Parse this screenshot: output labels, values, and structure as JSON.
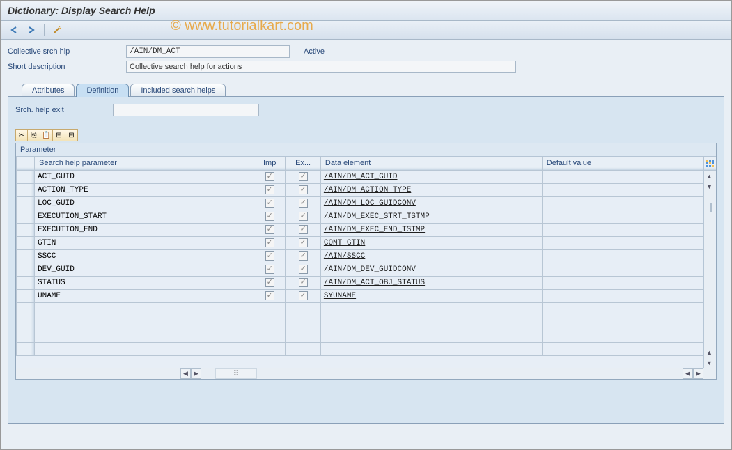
{
  "title": "Dictionary: Display Search Help",
  "watermark": "© www.tutorialkart.com",
  "toolbar": {},
  "fields": {
    "collective_label": "Collective srch hlp",
    "collective_value": "/AIN/DM_ACT",
    "status": "Active",
    "shortdesc_label": "Short description",
    "shortdesc_value": "Collective search help for actions"
  },
  "tabs": {
    "attributes": "Attributes",
    "definition": "Definition",
    "included": "Included search helps"
  },
  "definition": {
    "exit_label": "Srch. help exit",
    "exit_value": "",
    "table_title": "Parameter",
    "columns": {
      "param": "Search help parameter",
      "imp": "Imp",
      "exp": "Ex...",
      "de": "Data element",
      "def": "Default value"
    },
    "rows": [
      {
        "param": "ACT_GUID",
        "imp": true,
        "exp": true,
        "de": "/AIN/DM_ACT_GUID",
        "def": ""
      },
      {
        "param": "ACTION_TYPE",
        "imp": true,
        "exp": true,
        "de": "/AIN/DM_ACTION_TYPE",
        "def": ""
      },
      {
        "param": "LOC_GUID",
        "imp": true,
        "exp": true,
        "de": "/AIN/DM_LOC_GUIDCONV",
        "def": ""
      },
      {
        "param": "EXECUTION_START",
        "imp": true,
        "exp": true,
        "de": "/AIN/DM_EXEC_STRT_TSTMP",
        "def": ""
      },
      {
        "param": "EXECUTION_END",
        "imp": true,
        "exp": true,
        "de": "/AIN/DM_EXEC_END_TSTMP",
        "def": ""
      },
      {
        "param": "GTIN",
        "imp": true,
        "exp": true,
        "de": "COMT_GTIN",
        "def": ""
      },
      {
        "param": "SSCC",
        "imp": true,
        "exp": true,
        "de": "/AIN/SSCC",
        "def": ""
      },
      {
        "param": "DEV_GUID",
        "imp": true,
        "exp": true,
        "de": "/AIN/DM_DEV_GUIDCONV",
        "def": ""
      },
      {
        "param": "STATUS",
        "imp": true,
        "exp": true,
        "de": "/AIN/DM_ACT_OBJ_STATUS",
        "def": ""
      },
      {
        "param": "UNAME",
        "imp": true,
        "exp": true,
        "de": "SYUNAME",
        "def": ""
      },
      {
        "param": "",
        "imp": false,
        "exp": false,
        "de": "",
        "def": ""
      },
      {
        "param": "",
        "imp": false,
        "exp": false,
        "de": "",
        "def": ""
      },
      {
        "param": "",
        "imp": false,
        "exp": false,
        "de": "",
        "def": ""
      },
      {
        "param": "",
        "imp": false,
        "exp": false,
        "de": "",
        "def": ""
      }
    ]
  }
}
